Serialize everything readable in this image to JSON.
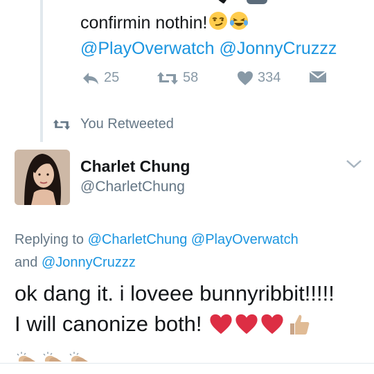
{
  "prev_tweet": {
    "text": "confirmin nothin!",
    "emojis": [
      "smirk-emoji",
      "joy-emoji"
    ],
    "mentions": "@PlayOverwatch @JonnyCruzzz",
    "actions": {
      "reply_count": "25",
      "retweet_count": "58",
      "like_count": "334"
    }
  },
  "retweet_notice": "You Retweeted",
  "tweet": {
    "author_name": "Charlet Chung",
    "author_handle": "@CharletChung",
    "replying_prefix": "Replying to",
    "replying_handles": [
      "@CharletChung",
      "@PlayOverwatch"
    ],
    "replying_and": "and",
    "replying_last": "@JonnyCruzzz",
    "line1": "ok dang it. i loveee bunnyribbit!!!!!",
    "line2": "I will canonize both!",
    "emojis": [
      "heart-emoji",
      "heart-emoji",
      "heart-emoji",
      "thumbs-up-emoji",
      "clapping-hands-emoji",
      "clapping-hands-emoji",
      "clapping-hands-emoji"
    ]
  },
  "colors": {
    "link": "#1b95e0",
    "muted": "#657786",
    "icon_gray": "#8899a6",
    "heart_red": "#dd2e44"
  }
}
